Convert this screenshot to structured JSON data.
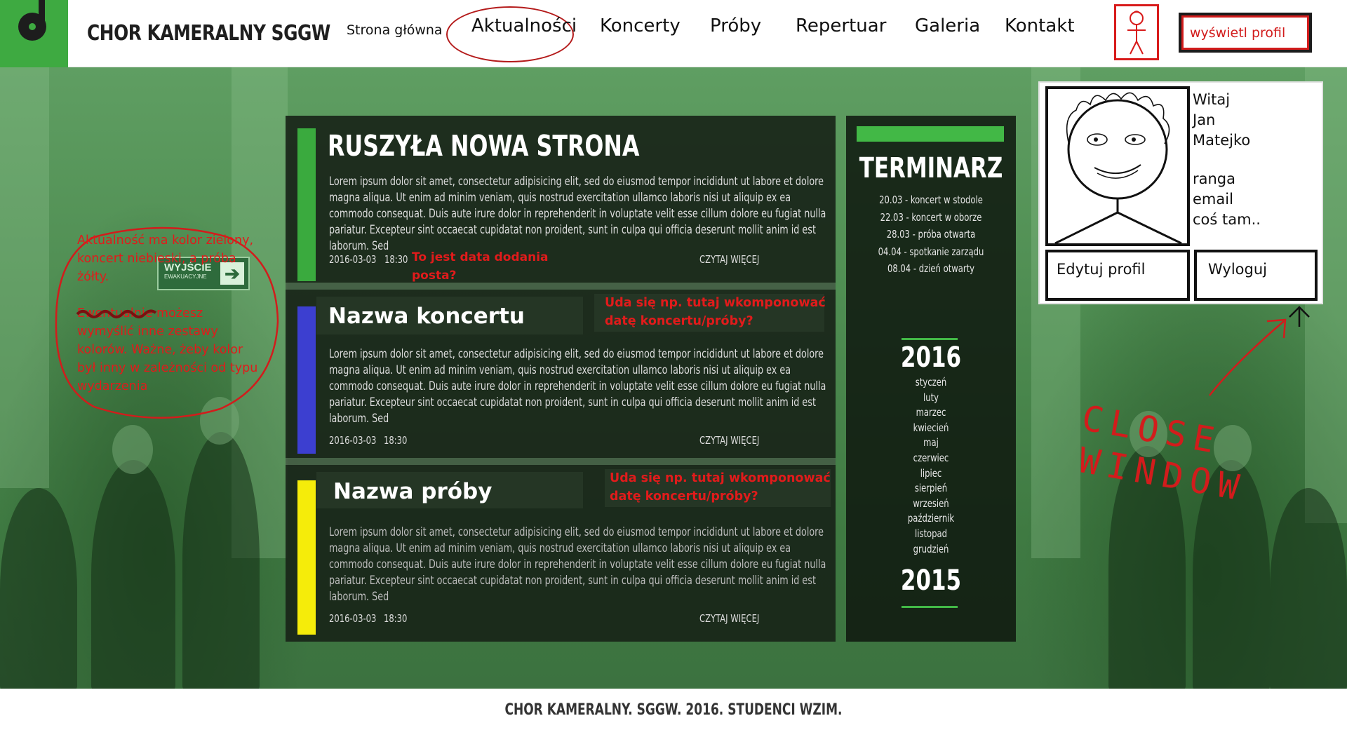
{
  "header": {
    "site_title": "CHOR KAMERALNY SGGW",
    "nav": [
      "Strona główna",
      "Aktualności",
      "Koncerty",
      "Próby",
      "Repertuar",
      "Galeria",
      "Kontakt"
    ],
    "profile_button": "wyświetl profil"
  },
  "background": {
    "exit_sign": "WYJŚCIE",
    "exit_sign_small": "EWAKUACYJNE"
  },
  "posts": [
    {
      "title": "RUSZYŁA NOWA STRONA",
      "bar_color": "#3aaa3e",
      "body": "Lorem ipsum dolor sit amet, consectetur adipisicing elit, sed do eiusmod tempor incididunt ut labore et dolore magna aliqua. Ut enim ad minim veniam, quis nostrud exercitation ullamco laboris nisi ut aliquip ex ea commodo consequat. Duis aute irure dolor in reprehenderit in voluptate velit esse cillum dolore eu fugiat nulla pariatur. Excepteur sint occaecat cupidatat non proident, sunt in culpa qui officia deserunt mollit anim id est laborum. Sed",
      "date": "2016-03-03",
      "time": "18:30",
      "more": "CZYTAJ WIĘCEJ",
      "note": "To jest data dodania posta?"
    },
    {
      "title": "Nazwa koncertu",
      "bar_color": "#3c3fd0",
      "body": "Lorem ipsum dolor sit amet, consectetur adipisicing elit, sed do eiusmod tempor incididunt ut labore et dolore magna aliqua. Ut enim ad minim veniam, quis nostrud exercitation ullamco laboris nisi ut aliquip ex ea commodo consequat. Duis aute irure dolor in reprehenderit in voluptate velit esse cillum dolore eu fugiat nulla pariatur. Excepteur sint occaecat cupidatat non proident, sunt in culpa qui officia deserunt mollit anim id est laborum. Sed",
      "date": "2016-03-03",
      "time": "18:30",
      "more": "CZYTAJ WIĘCEJ",
      "note": "Uda się np. tutaj wkomponować datę koncertu/próby?"
    },
    {
      "title": "Nazwa próby",
      "bar_color": "#f5ec0a",
      "body": "Lorem ipsum dolor sit amet, consectetur adipisicing elit, sed do eiusmod tempor incididunt ut labore et dolore magna aliqua. Ut enim ad minim veniam, quis nostrud exercitation ullamco laboris nisi ut aliquip ex ea commodo consequat. Duis aute irure dolor in reprehenderit in voluptate velit esse cillum dolore eu fugiat nulla pariatur. Excepteur sint occaecat cupidatat non proident, sunt in culpa qui officia deserunt mollit anim id est laborum. Sed",
      "date": "2016-03-03",
      "time": "18:30",
      "more": "CZYTAJ WIĘCEJ",
      "note": "Uda się np. tutaj wkomponować datę koncertu/próby?"
    }
  ],
  "left_note": {
    "line1": "Aktualność ma kolor zielony, koncert niebieski, a próba żółty.",
    "line2": "Ewentualnie możesz wymyślić inne zestawy kolorów. Ważne, żeby kolor był inny w zależności od typu wydarzenia"
  },
  "calendar": {
    "title": "TERMINARZ",
    "events": [
      "20.03 - koncert w stodole",
      "22.03 - koncert w oborze",
      "28.03 - próba otwarta",
      "04.04 - spotkanie zarządu",
      "08.04 - dzień otwarty"
    ],
    "year_current": "2016",
    "months": [
      "styczeń",
      "luty",
      "marzec",
      "kwiecień",
      "maj",
      "czerwiec",
      "lipiec",
      "sierpień",
      "wrzesień",
      "październik",
      "listopad",
      "grudzień"
    ],
    "year_prev": "2015"
  },
  "profile": {
    "greeting": "Witaj",
    "first_name": "Jan",
    "last_name": "Matejko",
    "rank": "ranga",
    "email": "email",
    "other": "coś tam..",
    "edit_button": "Edytuj profil",
    "logout_button": "Wyloguj"
  },
  "annotation": {
    "close_line1": "CLOSE",
    "close_line2": "WINDOW"
  },
  "footer": {
    "text": "CHOR KAMERALNY. SGGW. 2016. STUDENCI WZIM."
  }
}
